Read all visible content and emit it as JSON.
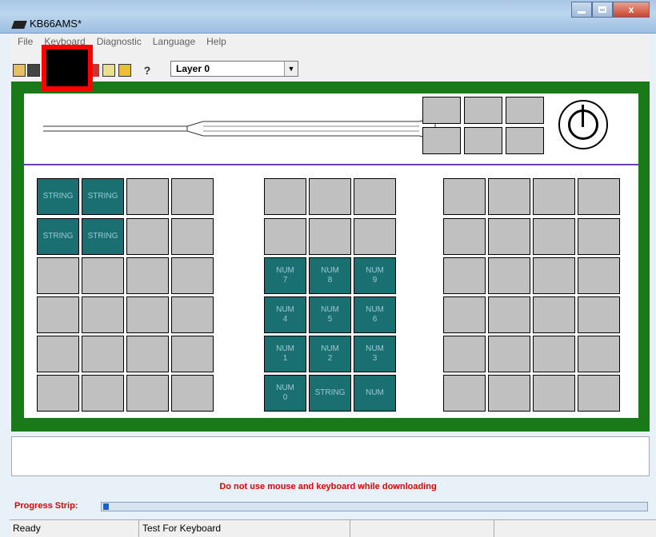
{
  "window": {
    "title": "KB66AMS*",
    "min_label": "",
    "max_label": "",
    "close_label": "x"
  },
  "menu": [
    "File",
    "Keyboard",
    "Diagnostic",
    "Language",
    "Help"
  ],
  "toolbar": {
    "layer_select": "Layer 0",
    "icons": [
      "open-icon",
      "save-icon",
      "red-redacted-icon",
      "edit-icon",
      "layer-icon",
      "help-icon"
    ]
  },
  "rows": 6,
  "left_block": [
    [
      "STRING",
      "STRING",
      "",
      ""
    ],
    [
      "STRING",
      "STRING",
      "",
      ""
    ],
    [
      "",
      "",
      "",
      ""
    ],
    [
      "",
      "",
      "",
      ""
    ],
    [
      "",
      "",
      "",
      ""
    ],
    [
      "",
      "",
      "",
      ""
    ]
  ],
  "middle_block": [
    [
      "",
      "",
      ""
    ],
    [
      "",
      "",
      ""
    ],
    [
      "NUM\n7",
      "NUM\n8",
      "NUM\n9"
    ],
    [
      "NUM\n4",
      "NUM\n5",
      "NUM\n6"
    ],
    [
      "NUM\n1",
      "NUM\n2",
      "NUM\n3"
    ],
    [
      "NUM\n0",
      "STRING",
      "NUM"
    ]
  ],
  "right_block": [
    [
      "",
      "",
      "",
      ""
    ],
    [
      "",
      "",
      "",
      ""
    ],
    [
      "",
      "",
      "",
      ""
    ],
    [
      "",
      "",
      "",
      ""
    ],
    [
      "",
      "",
      "",
      ""
    ],
    [
      "",
      "",
      "",
      ""
    ]
  ],
  "warning": "Do not use mouse and keyboard while downloading",
  "progress": {
    "label": "Progress Strip:",
    "value": 0.01
  },
  "status": {
    "left": "Ready",
    "middle": "Test For Keyboard",
    "right": ""
  },
  "colors": {
    "frame": "#1a7a1a",
    "teal_key": "#1a7070",
    "gray_key": "#c0c0c0",
    "warning": "#e00000"
  }
}
